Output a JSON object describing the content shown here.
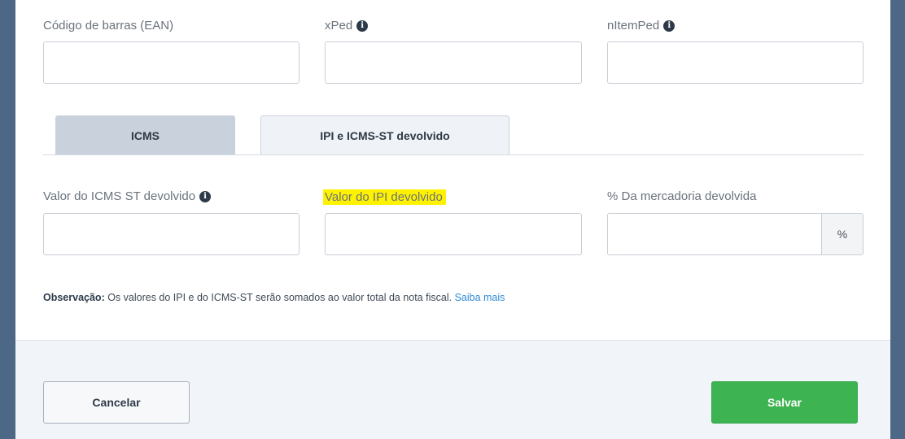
{
  "fields_row1": {
    "ean_label": "Código de barras (EAN)",
    "ean_value": "",
    "xped_label": "xPed",
    "xped_value": "",
    "nitemped_label": "nItemPed",
    "nitemped_value": ""
  },
  "tabs": [
    {
      "label": "ICMS",
      "active": false
    },
    {
      "label": "IPI e ICMS-ST devolvido",
      "active": true
    }
  ],
  "fields_row2": {
    "icms_st_label": "Valor do ICMS ST devolvido",
    "icms_st_value": "",
    "ipi_label": "Valor do IPI devolvido",
    "ipi_value": "",
    "pct_label": "% Da mercadoria devolvida",
    "pct_value": "",
    "pct_addon": "%"
  },
  "note": {
    "prefix": "Observação:",
    "text": " Os valores do IPI e do ICMS-ST serão somados ao valor total da nota fiscal. ",
    "link": "Saiba mais"
  },
  "footer": {
    "cancel_label": "Cancelar",
    "save_label": "Salvar"
  },
  "icons": {
    "info": "info-circle-icon",
    "info_glyph": "i"
  },
  "colors": {
    "overlay": "#4d6886",
    "save_green": "#3db352",
    "link_blue": "#2e8bd6",
    "highlight": "#fff200"
  }
}
